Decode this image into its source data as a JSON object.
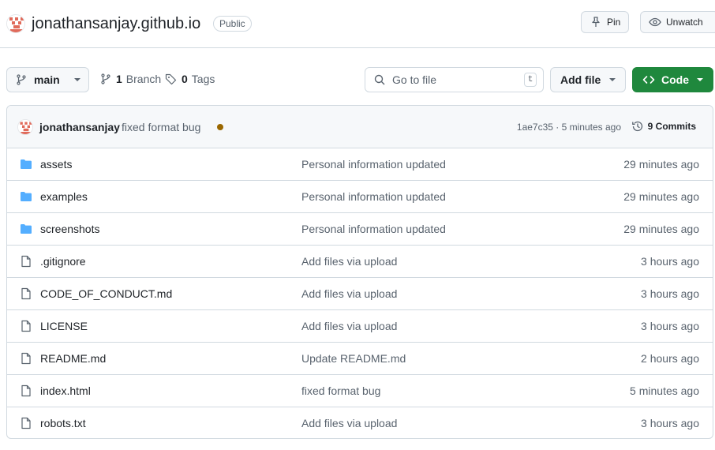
{
  "repo": {
    "name": "jonathansanjay.github.io",
    "visibility": "Public",
    "pin_label": "Pin",
    "unwatch_label": "Unwatch"
  },
  "toolbar": {
    "branch": "main",
    "branches_count": "1",
    "branches_label": "Branch",
    "tags_count": "0",
    "tags_label": "Tags",
    "search_placeholder": "Go to file",
    "search_shortcut": "t",
    "add_file_label": "Add file",
    "code_label": "Code"
  },
  "latest_commit": {
    "author": "jonathansanjay",
    "message": "fixed format bug",
    "status_color": "#9a6700",
    "meta": "1ae7c35 · 5 minutes ago",
    "commits_label": "9 Commits"
  },
  "colors": {
    "accent_green": "#1f883d",
    "folder_blue": "#54aeff"
  },
  "files": [
    {
      "name": "assets",
      "type": "folder",
      "message": "Personal information updated",
      "age": "29 minutes ago"
    },
    {
      "name": "examples",
      "type": "folder",
      "message": "Personal information updated",
      "age": "29 minutes ago"
    },
    {
      "name": "screenshots",
      "type": "folder",
      "message": "Personal information updated",
      "age": "29 minutes ago"
    },
    {
      "name": ".gitignore",
      "type": "file",
      "message": "Add files via upload",
      "age": "3 hours ago"
    },
    {
      "name": "CODE_OF_CONDUCT.md",
      "type": "file",
      "message": "Add files via upload",
      "age": "3 hours ago"
    },
    {
      "name": "LICENSE",
      "type": "file",
      "message": "Add files via upload",
      "age": "3 hours ago"
    },
    {
      "name": "README.md",
      "type": "file",
      "message": "Update README.md",
      "age": "2 hours ago"
    },
    {
      "name": "index.html",
      "type": "file",
      "message": "fixed format bug",
      "age": "5 minutes ago"
    },
    {
      "name": "robots.txt",
      "type": "file",
      "message": "Add files via upload",
      "age": "3 hours ago"
    }
  ]
}
